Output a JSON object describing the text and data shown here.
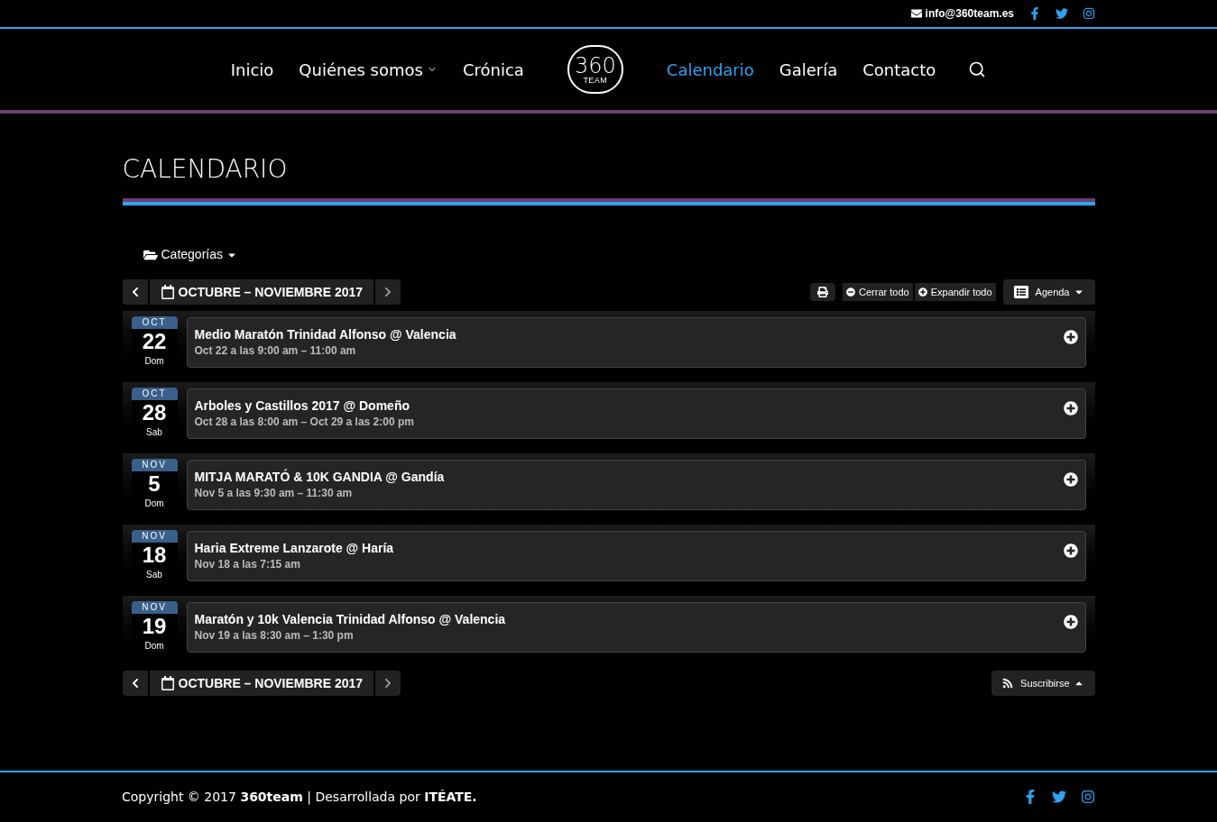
{
  "top_bar": {
    "email": "info@360team.es"
  },
  "nav": {
    "items": [
      {
        "label": "Inicio",
        "selected": false,
        "has_submenu": false
      },
      {
        "label": "Quiénes somos",
        "selected": false,
        "has_submenu": true
      },
      {
        "label": "Crónica",
        "selected": false,
        "has_submenu": false
      },
      {
        "label": "Calendario",
        "selected": true,
        "has_submenu": false
      },
      {
        "label": "Galería",
        "selected": false,
        "has_submenu": false
      },
      {
        "label": "Contacto",
        "selected": false,
        "has_submenu": false
      }
    ],
    "logo": {
      "number": "360",
      "subtitle": "TEAM"
    }
  },
  "page_title": "CALENDARIO",
  "categories_label": "Categorías",
  "range_label": "OCTUBRE – NOVIEMBRE 2017",
  "toolbar": {
    "collapse": "Cerrar todo",
    "expand": "Expandir todo",
    "view": "Agenda"
  },
  "events": [
    {
      "month": "OCT",
      "day": "22",
      "weekday": "Dom",
      "title": "Medio Maratón Trinidad Alfonso @ Valencia",
      "time": "Oct 22 a las 9:00 am – 11:00 am"
    },
    {
      "month": "OCT",
      "day": "28",
      "weekday": "Sab",
      "title": "Arboles y Castillos 2017 @ Domeño",
      "time": "Oct 28 a las 8:00 am – Oct 29 a las 2:00 pm"
    },
    {
      "month": "NOV",
      "day": "5",
      "weekday": "Dom",
      "title": "MITJA MARATÓ & 10K GANDIA @ Gandía",
      "time": "Nov 5 a las 9:30 am – 11:30 am"
    },
    {
      "month": "NOV",
      "day": "18",
      "weekday": "Sab",
      "title": "Haria Extreme Lanzarote @ Haría",
      "time": "Nov 18 a las 7:15 am"
    },
    {
      "month": "NOV",
      "day": "19",
      "weekday": "Dom",
      "title": "Maratón y 10k Valencia Trinidad Alfonso @ Valencia",
      "time": "Nov 19 a las 8:30 am – 1:30 pm"
    }
  ],
  "bottom_range_label": "OCTUBRE – NOVIEMBRE 2017",
  "subscribe": "Suscribirse",
  "footer": {
    "copyright": "Copyright © 2017 **360team** | Desarrollada por **ITÉATE.**"
  }
}
